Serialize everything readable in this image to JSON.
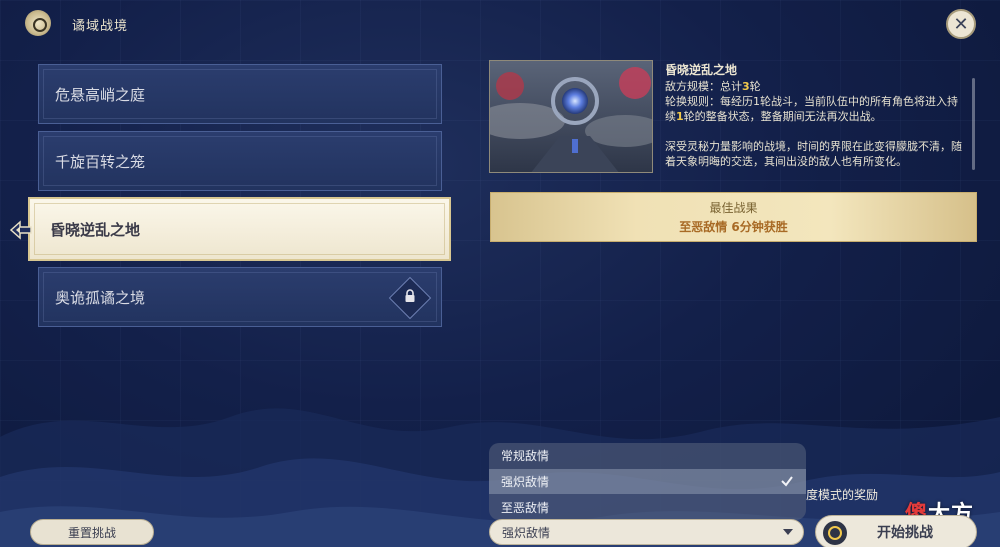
{
  "header": {
    "title": "谲域战境",
    "close_icon": "close-icon",
    "emblem_icon": "domain-emblem-icon"
  },
  "domains": [
    {
      "label": "危悬高峭之庭",
      "selected": false,
      "locked": false
    },
    {
      "label": "千旋百转之笼",
      "selected": false,
      "locked": false
    },
    {
      "label": "昏晓逆乱之地",
      "selected": true,
      "locked": false
    },
    {
      "label": "奥诡孤谲之境",
      "selected": false,
      "locked": true
    }
  ],
  "detail": {
    "title": "昏晓逆乱之地",
    "enemy_scale_prefix": "敌方规模：总计",
    "enemy_scale_value": "3",
    "enemy_scale_suffix": "轮",
    "rotation_rule_prefix": "轮换规则：每经历1轮战斗，当前队伍中的所有角色将进入持续",
    "rotation_rule_value": "1",
    "rotation_rule_suffix": "轮的整备状态，整备期间无法再次出战。",
    "description": "深受灵秘力量影响的战境，时间的界限在此变得朦胧不清，随着天象明晦的交迭，其间出没的敌人也有所变化。"
  },
  "best_result": {
    "label": "最佳战果",
    "value": "至恶敌情 6分钟获胜"
  },
  "difficulty": {
    "options": [
      "常规敌情",
      "强炽敌情",
      "至恶敌情"
    ],
    "selected": "强炽敌情",
    "selected_index": 1
  },
  "reward_text": "度模式的奖励",
  "watermark": {
    "part1": "傻",
    "part2": "大方"
  },
  "buttons": {
    "reset": "重置挑战",
    "start": "开始挑战"
  },
  "colors": {
    "background": "#13204a",
    "item_bg": "#22335f",
    "selected_bg": "#f3eddb",
    "highlight": "#f2c94c",
    "best_result_bg": "#f0e1b5",
    "button_bg": "#ece7da"
  }
}
